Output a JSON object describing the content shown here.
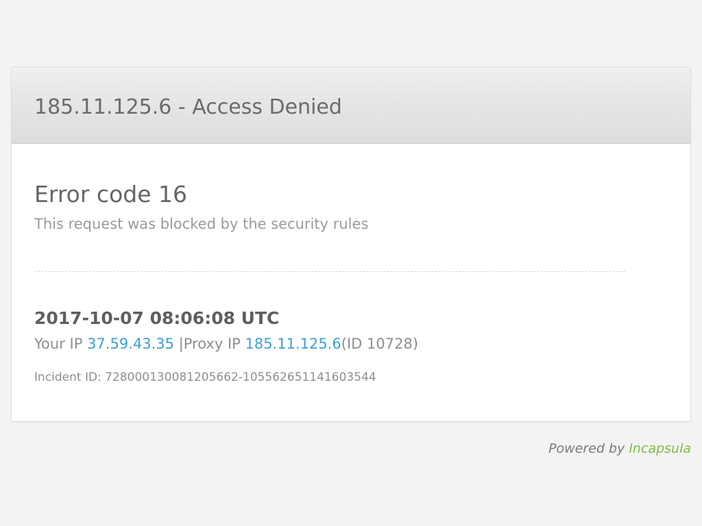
{
  "header": {
    "title": "185.11.125.6 - Access Denied"
  },
  "error": {
    "heading": "Error code 16",
    "description": "This request was blocked by the security rules"
  },
  "details": {
    "timestamp": "2017-10-07 08:06:08 UTC",
    "your_ip_label": "Your IP",
    "your_ip_value": "37.59.43.35",
    "separator": "|",
    "proxy_ip_label": "Proxy IP",
    "proxy_ip_value": "185.11.125.6",
    "proxy_id": "(ID 10728)",
    "incident": "Incident ID: 728000130081205662-105562651141603544"
  },
  "footer": {
    "powered_label": "Powered by",
    "brand": "Incapsula"
  },
  "colors": {
    "link": "#3e9fd3",
    "brand": "#7cbf3c",
    "page_background": "#f3f3f3"
  }
}
